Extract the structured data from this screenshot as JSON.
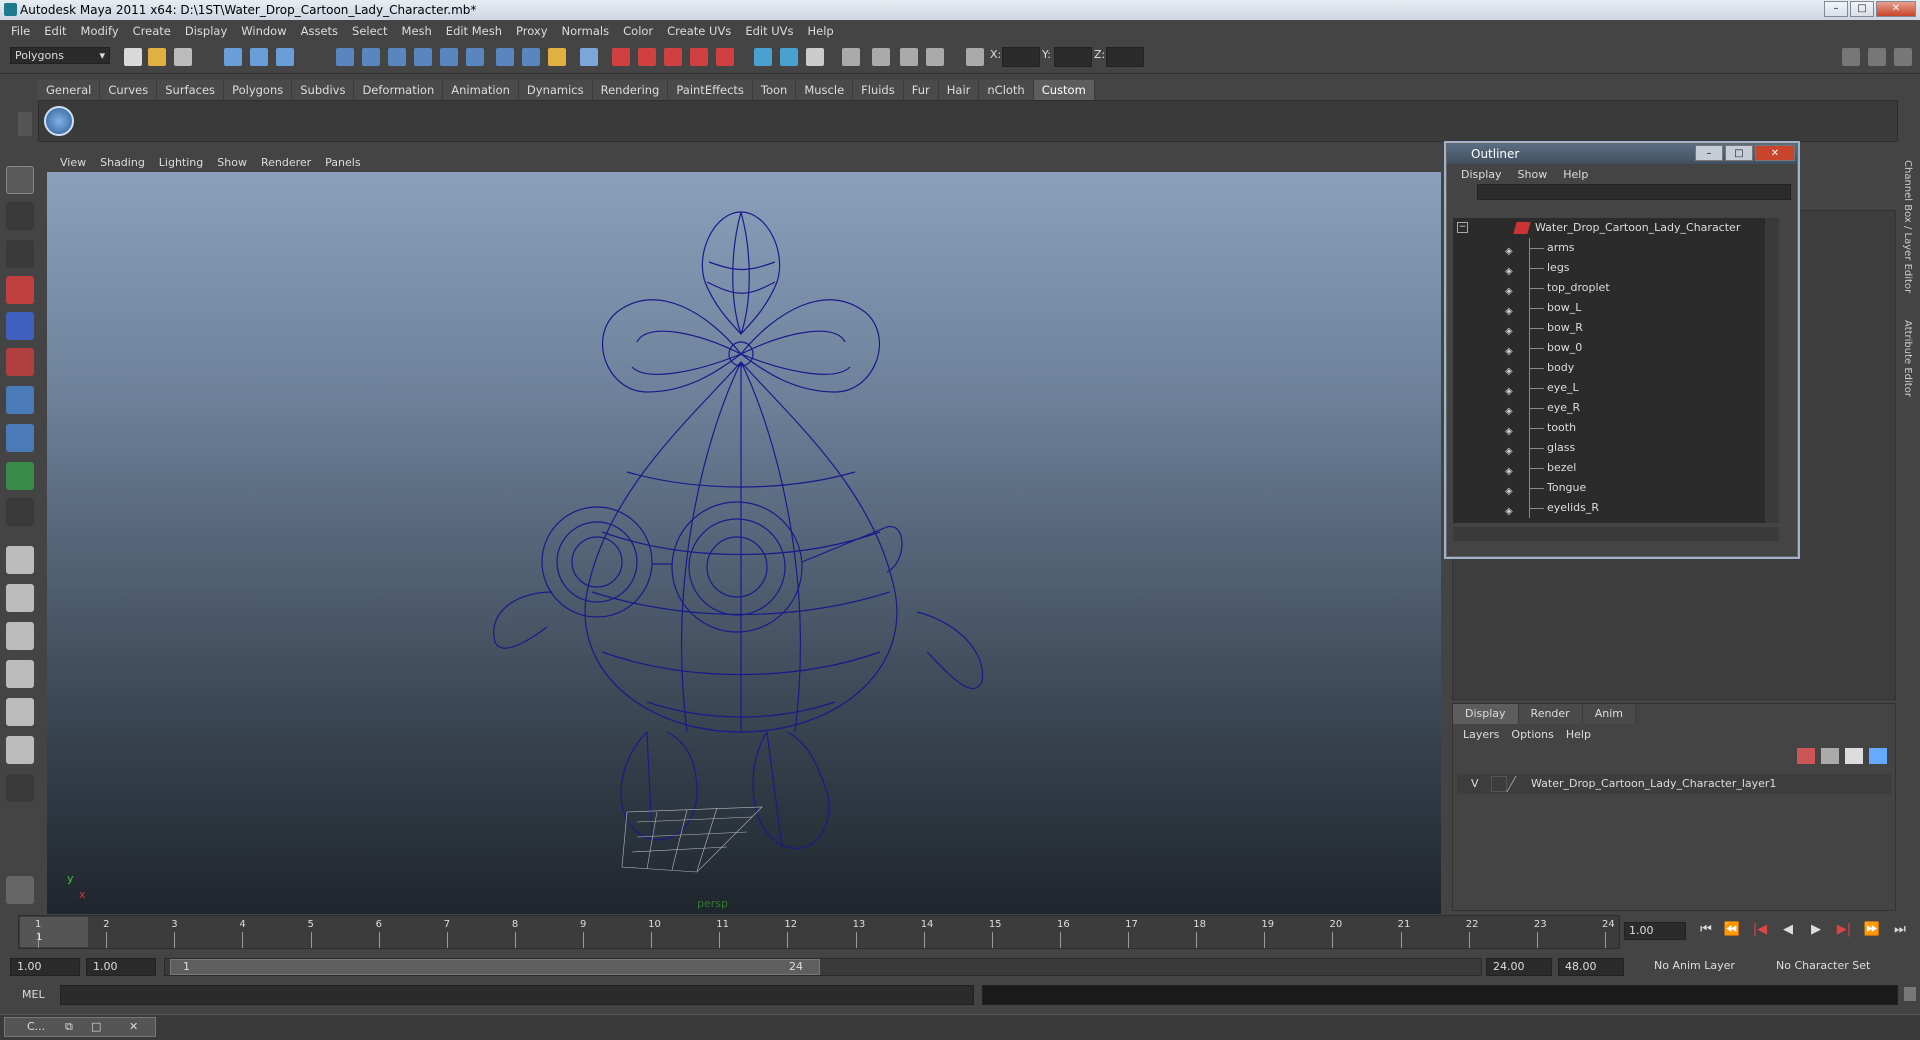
{
  "window": {
    "title": "Autodesk Maya 2011 x64: D:\\1ST\\Water_Drop_Cartoon_Lady_Character.mb*"
  },
  "menubar": [
    "File",
    "Edit",
    "Modify",
    "Create",
    "Display",
    "Window",
    "Assets",
    "Select",
    "Mesh",
    "Edit Mesh",
    "Proxy",
    "Normals",
    "Color",
    "Create UVs",
    "Edit UVs",
    "Help"
  ],
  "statusline": {
    "mode": "Polygons",
    "x_label": "X:",
    "y_label": "Y:",
    "z_label": "Z:"
  },
  "shelf": {
    "tabs": [
      "General",
      "Curves",
      "Surfaces",
      "Polygons",
      "Subdivs",
      "Deformation",
      "Animation",
      "Dynamics",
      "Rendering",
      "PaintEffects",
      "Toon",
      "Muscle",
      "Fluids",
      "Fur",
      "Hair",
      "nCloth",
      "Custom"
    ],
    "active": "Custom"
  },
  "viewport": {
    "menu": [
      "View",
      "Shading",
      "Lighting",
      "Show",
      "Renderer",
      "Panels"
    ],
    "camera_label": "persp",
    "axis_y": "y",
    "axis_x": "x"
  },
  "outliner": {
    "title": "Outliner",
    "menu": [
      "Display",
      "Show",
      "Help"
    ],
    "root": "Water_Drop_Cartoon_Lady_Character",
    "items": [
      "arms",
      "legs",
      "top_droplet",
      "bow_L",
      "bow_R",
      "bow_0",
      "body",
      "eye_L",
      "eye_R",
      "tooth",
      "glass",
      "bezel",
      "Tongue",
      "eyelids_R"
    ]
  },
  "sidetabs": {
    "channel": "Channel Box / Layer Editor",
    "attribute": "Attribute Editor"
  },
  "layers": {
    "tabs": [
      "Display",
      "Render",
      "Anim"
    ],
    "active": "Display",
    "menu": [
      "Layers",
      "Options",
      "Help"
    ],
    "visibility": "V",
    "layer_name": "Water_Drop_Cartoon_Lady_Character_layer1"
  },
  "timeline": {
    "ticks": [
      "1",
      "2",
      "3",
      "4",
      "5",
      "6",
      "7",
      "8",
      "9",
      "10",
      "11",
      "12",
      "13",
      "14",
      "15",
      "16",
      "17",
      "18",
      "19",
      "20",
      "21",
      "22",
      "23",
      "24"
    ],
    "current_frame": "1.00",
    "playhead": "1"
  },
  "range": {
    "start_outer": "1.00",
    "start_inner": "1.00",
    "thumb_start": "1",
    "thumb_end": "24",
    "end_inner": "24.00",
    "end_outer": "48.00",
    "anim_layer": "No Anim Layer",
    "char_set": "No Character Set"
  },
  "cmd": {
    "label": "MEL"
  },
  "taskbar": {
    "item": "C..."
  }
}
